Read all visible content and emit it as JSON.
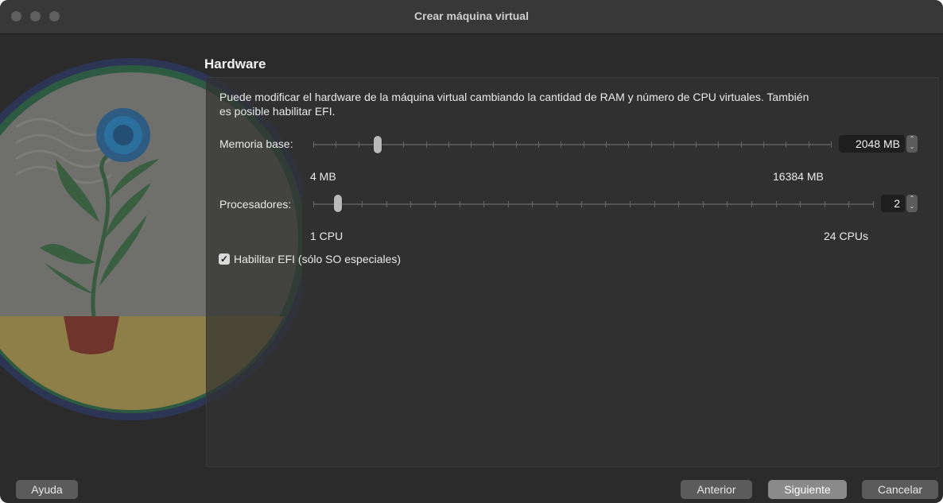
{
  "window": {
    "title": "Crear máquina virtual"
  },
  "page": {
    "heading": "Hardware",
    "description": "Puede modificar el hardware de la máquina virtual cambiando la cantidad de RAM y número de CPU virtuales. También es posible habilitar EFI."
  },
  "memory": {
    "label": "Memoria base:",
    "value": "2048 MB",
    "min_label": "4 MB",
    "max_label": "16384 MB",
    "min_value": 4,
    "max_value": 16384,
    "current_value": 2048
  },
  "processors": {
    "label": "Procesadores:",
    "value": "2",
    "min_label": "1 CPU",
    "max_label": "24 CPUs",
    "min_value": 1,
    "max_value": 24,
    "current_value": 2
  },
  "efi": {
    "label": "Habilitar EFI (sólo SO especiales)",
    "checked": true
  },
  "buttons": {
    "help": "Ayuda",
    "back": "Anterior",
    "next": "Siguiente",
    "cancel": "Cancelar"
  },
  "icons": {
    "checkmark": "checkmark-icon",
    "stepper_up": "chevron-up-icon",
    "stepper_down": "chevron-down-icon"
  }
}
